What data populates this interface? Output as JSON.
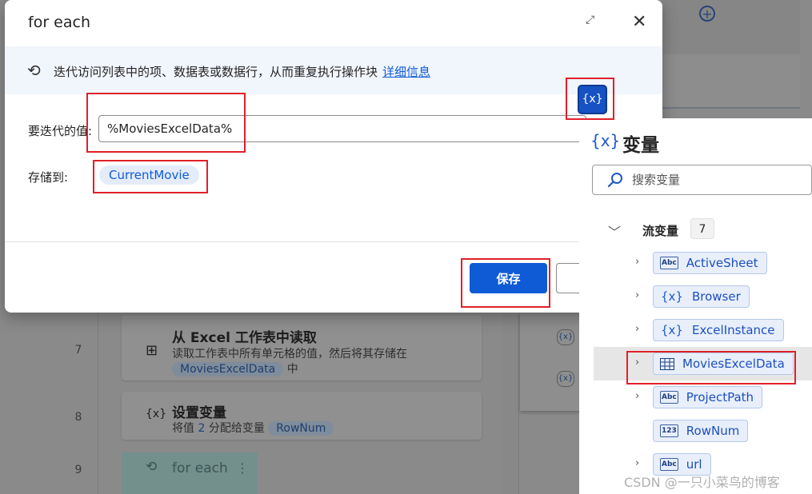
{
  "dialog": {
    "title": "for each",
    "info_text": "迭代访问列表中的项、数据表或数据行，从而重复执行操作块",
    "info_link": "详细信息",
    "value_label": "要迭代的值:",
    "value": "%MoviesExcelData%",
    "store_label": "存储到:",
    "store_var": "CurrentMovie",
    "save_label": "保存",
    "var_button_label": "{x}"
  },
  "variables_pane": {
    "title": "变量",
    "title_icon": "{x}",
    "search_placeholder": "搜索变量",
    "group_label": "流变量",
    "group_count": "7",
    "items": [
      {
        "name": "ActiveSheet",
        "type_icon": "Abc",
        "has_chevron": true
      },
      {
        "name": "Browser",
        "type_icon": "{x}",
        "has_chevron": true
      },
      {
        "name": "ExcelInstance",
        "type_icon": "{x}",
        "has_chevron": true
      },
      {
        "name": "MoviesExcelData",
        "type_icon": "table",
        "has_chevron": true,
        "selected": true
      },
      {
        "name": "ProjectPath",
        "type_icon": "Abc",
        "has_chevron": true
      },
      {
        "name": "RowNum",
        "type_icon": "123",
        "has_chevron": false
      },
      {
        "name": "url",
        "type_icon": "Abc",
        "has_chevron": true
      }
    ]
  },
  "flow_steps": [
    {
      "line": "7",
      "icon": "excel-read-icon",
      "title": "从 Excel 工作表中读取",
      "desc_prefix": "读取工作表中所有单元格的值，然后将其存储在",
      "desc_var": "MoviesExcelData",
      "desc_suffix": "中"
    },
    {
      "line": "8",
      "icon": "{x}",
      "title": "设置变量",
      "desc_prefix": "将值",
      "desc_value": "2",
      "desc_mid": "分配给变量",
      "desc_var": "RowNum"
    },
    {
      "line": "9",
      "icon": "loop-icon",
      "title": "for each"
    }
  ],
  "watermark": "CSDN @一只小菜鸟的博客",
  "colors": {
    "accent": "#0f5bd6",
    "highlight": "#e0202a"
  }
}
